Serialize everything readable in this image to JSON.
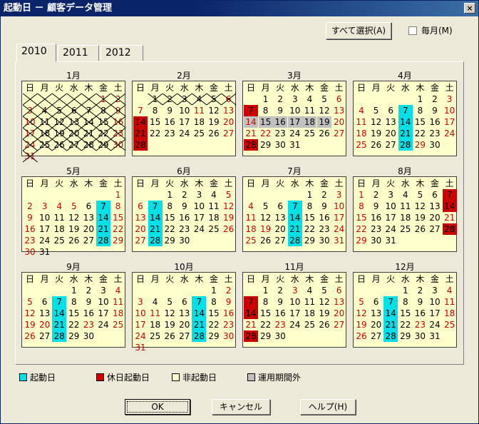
{
  "window": {
    "title": "起動日 － 顧客データ管理",
    "close_label": "×"
  },
  "toolbar": {
    "select_all_label": "すべて選択(A)",
    "monthly_label": "毎月(M)"
  },
  "tabs": [
    {
      "label": "2010"
    },
    {
      "label": "2011"
    },
    {
      "label": "2012"
    }
  ],
  "weekday_headers": [
    "日",
    "月",
    "火",
    "水",
    "木",
    "金",
    "土"
  ],
  "colors": {
    "startup_day": "#00e0e8",
    "holiday_startup": "#cc0000",
    "non_startup": "#ffffcc",
    "out_of_period": "#c0c0c0",
    "sunday_text": "#cc0000"
  },
  "months": [
    {
      "label": "1月",
      "start": 5,
      "days": 31,
      "crossed": true,
      "red": [
        1,
        2,
        3,
        9,
        10,
        16,
        17,
        23,
        24,
        30,
        31
      ],
      "cyan": [],
      "holiday": [],
      "gray": []
    },
    {
      "label": "2月",
      "start": 1,
      "days": 28,
      "crossed_days": [
        1,
        2,
        3,
        4,
        5,
        6
      ],
      "red": [
        6,
        7,
        11,
        13,
        14,
        20,
        21,
        27,
        28
      ],
      "cyan": [],
      "holiday": [
        14,
        21,
        28
      ],
      "gray": []
    },
    {
      "label": "3月",
      "start": 1,
      "days": 31,
      "red": [
        6,
        7,
        13,
        14,
        20,
        21,
        22,
        27,
        28
      ],
      "cyan": [],
      "holiday": [
        7,
        28
      ],
      "gray": [
        14,
        15,
        16,
        17,
        18,
        19
      ]
    },
    {
      "label": "4月",
      "start": 4,
      "days": 30,
      "red": [
        3,
        4,
        10,
        11,
        17,
        18,
        24,
        25,
        29
      ],
      "cyan": [
        7,
        14,
        21,
        28
      ],
      "holiday": [],
      "gray": []
    },
    {
      "label": "5月",
      "start": 6,
      "days": 31,
      "red": [
        1,
        2,
        3,
        4,
        5,
        8,
        9,
        15,
        16,
        22,
        23,
        29,
        30
      ],
      "cyan": [
        7,
        14,
        21,
        28
      ],
      "holiday": [],
      "gray": []
    },
    {
      "label": "6月",
      "start": 2,
      "days": 30,
      "red": [
        5,
        6,
        12,
        13,
        19,
        20,
        26,
        27
      ],
      "cyan": [
        7,
        14,
        21,
        28
      ],
      "holiday": [],
      "gray": []
    },
    {
      "label": "7月",
      "start": 4,
      "days": 31,
      "red": [
        3,
        4,
        10,
        11,
        17,
        18,
        19,
        24,
        25,
        31
      ],
      "cyan": [
        7,
        14,
        21,
        28
      ],
      "holiday": [],
      "gray": []
    },
    {
      "label": "8月",
      "start": 0,
      "days": 31,
      "red": [
        1,
        7,
        8,
        14,
        15,
        21,
        22,
        28,
        29
      ],
      "cyan": [],
      "holiday": [
        7,
        14,
        28
      ],
      "gray": []
    },
    {
      "label": "9月",
      "start": 3,
      "days": 30,
      "red": [
        4,
        5,
        11,
        12,
        18,
        19,
        20,
        23,
        25,
        26
      ],
      "cyan": [
        7,
        14,
        21,
        28
      ],
      "holiday": [],
      "gray": []
    },
    {
      "label": "10月",
      "start": 5,
      "days": 31,
      "red": [
        2,
        3,
        9,
        10,
        11,
        16,
        17,
        23,
        24,
        30,
        31
      ],
      "cyan": [
        7,
        14,
        21,
        28
      ],
      "holiday": [],
      "gray": []
    },
    {
      "label": "11月",
      "start": 1,
      "days": 30,
      "red": [
        3,
        6,
        7,
        13,
        14,
        20,
        21,
        23,
        27,
        28
      ],
      "cyan": [],
      "holiday": [
        7,
        14,
        28
      ],
      "gray": []
    },
    {
      "label": "12月",
      "start": 3,
      "days": 31,
      "red": [
        4,
        5,
        11,
        12,
        18,
        19,
        23,
        25,
        26
      ],
      "cyan": [
        7,
        14,
        21,
        28
      ],
      "holiday": [],
      "gray": []
    }
  ],
  "legend": [
    {
      "label": "起動日",
      "color": "#00e0e8"
    },
    {
      "label": "休日起動日",
      "color": "#cc0000"
    },
    {
      "label": "非起動日",
      "color": "#ffffcc"
    },
    {
      "label": "運用期間外",
      "color": "#c0c0c0"
    }
  ],
  "buttons": {
    "ok_label": "OK",
    "cancel_label": "キャンセル",
    "help_label": "ヘルプ(H)"
  }
}
